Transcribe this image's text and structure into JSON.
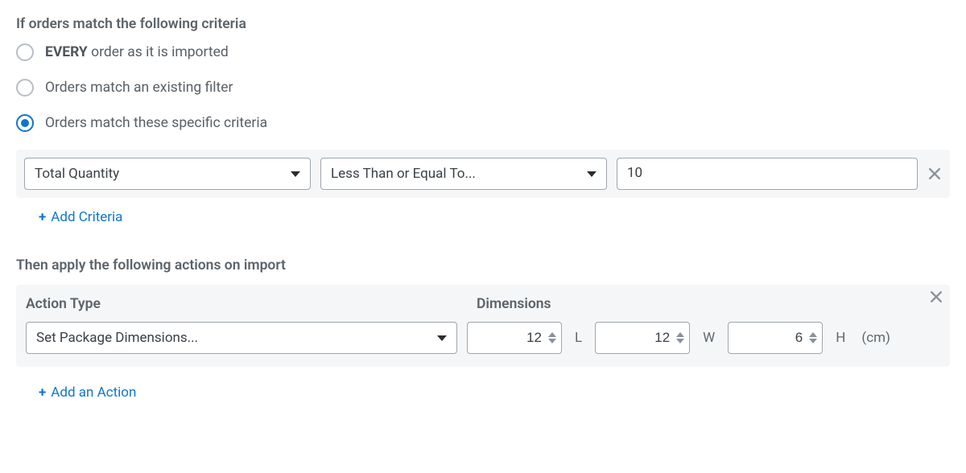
{
  "criteria": {
    "heading": "If orders match the following criteria",
    "options": [
      {
        "label_prefix": "EVERY",
        "label_rest": " order as it is imported",
        "selected": false
      },
      {
        "label_prefix": "",
        "label_rest": "Orders match an existing filter",
        "selected": false
      },
      {
        "label_prefix": "",
        "label_rest": "Orders match these specific criteria",
        "selected": true
      }
    ],
    "row": {
      "field": "Total Quantity",
      "operator": "Less Than or Equal To...",
      "value": "10"
    },
    "add_label": "Add Criteria"
  },
  "actions": {
    "heading": "Then apply the following actions on import",
    "col_action": "Action Type",
    "col_dims": "Dimensions",
    "action_type": "Set Package Dimensions...",
    "dims": {
      "l_value": "12",
      "l_label": "L",
      "w_value": "12",
      "w_label": "W",
      "h_value": "6",
      "h_label": "H",
      "unit": "(cm)"
    },
    "add_label": "Add an Action"
  }
}
